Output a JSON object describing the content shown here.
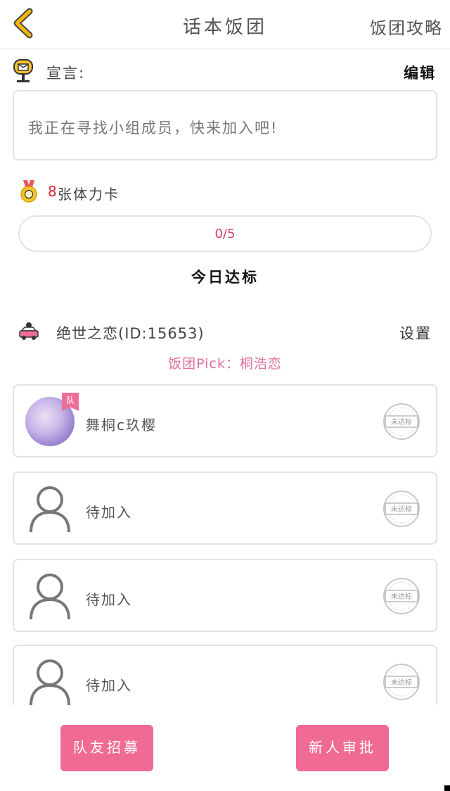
{
  "header": {
    "title": "话本饭团",
    "guide_label": "饭团攻略"
  },
  "declaration": {
    "label": "宣言:",
    "edit_label": "编辑",
    "text": "我正在寻找小组成员，快来加入吧!"
  },
  "stamina": {
    "count": "8",
    "unit": "张体力卡"
  },
  "progress": {
    "text": "0/5",
    "value": 0,
    "max": 5
  },
  "today_status": "今日达标",
  "group": {
    "name": "绝世之恋(ID:15653)",
    "settings_label": "设置",
    "pick": "饭团Pick：桐浩恋"
  },
  "members": [
    {
      "name": "舞桐c玖樱",
      "badge": "队",
      "stamp": "未达标"
    },
    {
      "name": "待加入",
      "stamp": "未达标"
    },
    {
      "name": "待加入",
      "stamp": "未达标"
    },
    {
      "name": "待加入",
      "stamp": "未达标"
    }
  ],
  "actions": {
    "recruit_label": "队友招募",
    "approve_label": "新人审批"
  },
  "colors": {
    "accent": "#f06b93",
    "pick_text": "#e06f9a",
    "back_arrow": "#f2b705"
  }
}
